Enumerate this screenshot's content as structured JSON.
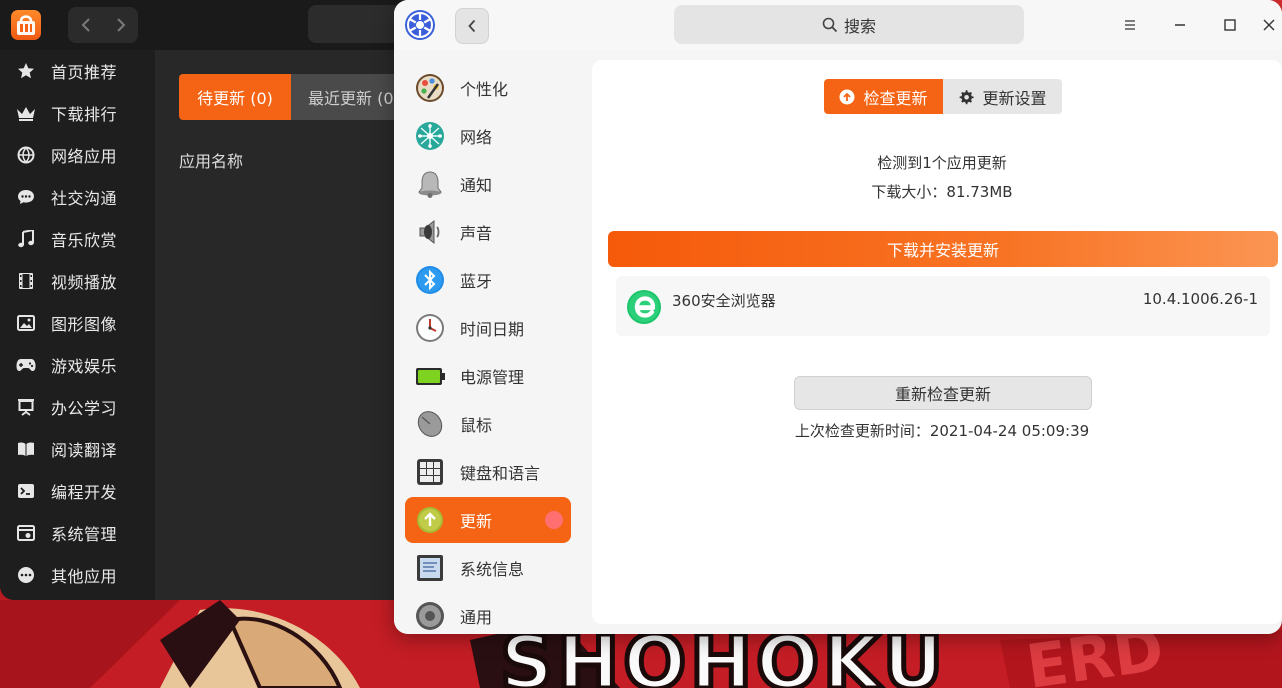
{
  "store": {
    "sidebar": [
      {
        "icon": "star-icon",
        "label": "首页推荐"
      },
      {
        "icon": "crown-icon",
        "label": "下载排行"
      },
      {
        "icon": "globe-icon",
        "label": "网络应用"
      },
      {
        "icon": "chat-icon",
        "label": "社交沟通"
      },
      {
        "icon": "music-note-icon",
        "label": "音乐欣赏"
      },
      {
        "icon": "film-icon",
        "label": "视频播放"
      },
      {
        "icon": "image-icon",
        "label": "图形图像"
      },
      {
        "icon": "gamepad-icon",
        "label": "游戏娱乐"
      },
      {
        "icon": "presentation-icon",
        "label": "办公学习"
      },
      {
        "icon": "book-icon",
        "label": "阅读翻译"
      },
      {
        "icon": "terminal-icon",
        "label": "编程开发"
      },
      {
        "icon": "system-icon",
        "label": "系统管理"
      },
      {
        "icon": "more-icon",
        "label": "其他应用"
      }
    ],
    "tabs": {
      "pending": "待更新 (0)",
      "recent": "最近更新 (0"
    },
    "column_header": "应用名称",
    "accent": "#f56414"
  },
  "control_center": {
    "search_label": "搜索",
    "nav": [
      {
        "icon": "personalization-icon",
        "label": "个性化"
      },
      {
        "icon": "network-icon",
        "label": "网络"
      },
      {
        "icon": "bell-icon",
        "label": "通知"
      },
      {
        "icon": "speaker-icon",
        "label": "声音"
      },
      {
        "icon": "bluetooth-icon",
        "label": "蓝牙"
      },
      {
        "icon": "clock-icon",
        "label": "时间日期"
      },
      {
        "icon": "battery-icon",
        "label": "电源管理"
      },
      {
        "icon": "mouse-icon",
        "label": "鼠标"
      },
      {
        "icon": "keyboard-icon",
        "label": "键盘和语言"
      },
      {
        "icon": "update-icon",
        "label": "更新",
        "active": true
      },
      {
        "icon": "system-info-icon",
        "label": "系统信息"
      },
      {
        "icon": "general-icon",
        "label": "通用"
      }
    ],
    "update": {
      "check_tab": "检查更新",
      "settings_tab": "更新设置",
      "found_text": "检测到1个应用更新",
      "size_text": "下载大小：81.73MB",
      "download_button": "下载并安装更新",
      "apps": [
        {
          "icon": "browser-360-icon",
          "name": "360安全浏览器",
          "version": "10.4.1006.26-1"
        }
      ],
      "recheck_button": "重新检查更新",
      "last_check": "上次检查更新时间：2021-04-24 05:09:39"
    }
  }
}
